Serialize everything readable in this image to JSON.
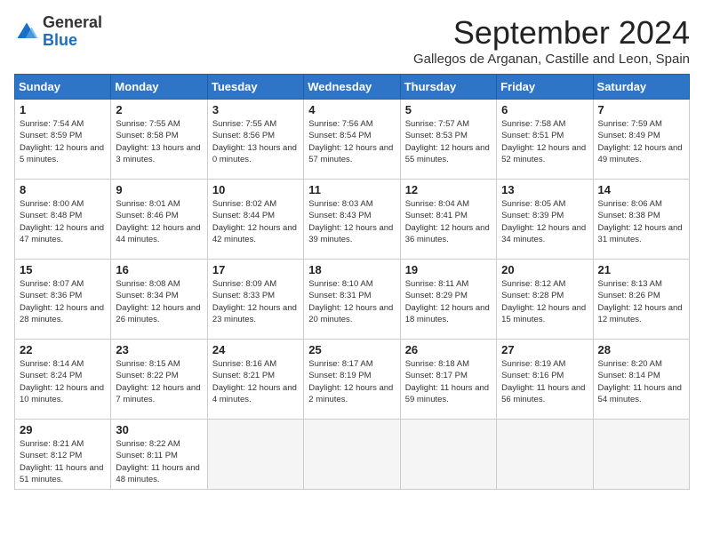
{
  "logo": {
    "general": "General",
    "blue": "Blue"
  },
  "header": {
    "month_title": "September 2024",
    "location": "Gallegos de Arganan, Castille and Leon, Spain"
  },
  "weekdays": [
    "Sunday",
    "Monday",
    "Tuesday",
    "Wednesday",
    "Thursday",
    "Friday",
    "Saturday"
  ],
  "weeks": [
    [
      {
        "day": 1,
        "sunrise": "7:54 AM",
        "sunset": "8:59 PM",
        "daylight": "12 hours and 5 minutes."
      },
      {
        "day": 2,
        "sunrise": "7:55 AM",
        "sunset": "8:58 PM",
        "daylight": "13 hours and 3 minutes."
      },
      {
        "day": 3,
        "sunrise": "7:55 AM",
        "sunset": "8:56 PM",
        "daylight": "13 hours and 0 minutes."
      },
      {
        "day": 4,
        "sunrise": "7:56 AM",
        "sunset": "8:54 PM",
        "daylight": "12 hours and 57 minutes."
      },
      {
        "day": 5,
        "sunrise": "7:57 AM",
        "sunset": "8:53 PM",
        "daylight": "12 hours and 55 minutes."
      },
      {
        "day": 6,
        "sunrise": "7:58 AM",
        "sunset": "8:51 PM",
        "daylight": "12 hours and 52 minutes."
      },
      {
        "day": 7,
        "sunrise": "7:59 AM",
        "sunset": "8:49 PM",
        "daylight": "12 hours and 49 minutes."
      }
    ],
    [
      {
        "day": 8,
        "sunrise": "8:00 AM",
        "sunset": "8:48 PM",
        "daylight": "12 hours and 47 minutes."
      },
      {
        "day": 9,
        "sunrise": "8:01 AM",
        "sunset": "8:46 PM",
        "daylight": "12 hours and 44 minutes."
      },
      {
        "day": 10,
        "sunrise": "8:02 AM",
        "sunset": "8:44 PM",
        "daylight": "12 hours and 42 minutes."
      },
      {
        "day": 11,
        "sunrise": "8:03 AM",
        "sunset": "8:43 PM",
        "daylight": "12 hours and 39 minutes."
      },
      {
        "day": 12,
        "sunrise": "8:04 AM",
        "sunset": "8:41 PM",
        "daylight": "12 hours and 36 minutes."
      },
      {
        "day": 13,
        "sunrise": "8:05 AM",
        "sunset": "8:39 PM",
        "daylight": "12 hours and 34 minutes."
      },
      {
        "day": 14,
        "sunrise": "8:06 AM",
        "sunset": "8:38 PM",
        "daylight": "12 hours and 31 minutes."
      }
    ],
    [
      {
        "day": 15,
        "sunrise": "8:07 AM",
        "sunset": "8:36 PM",
        "daylight": "12 hours and 28 minutes."
      },
      {
        "day": 16,
        "sunrise": "8:08 AM",
        "sunset": "8:34 PM",
        "daylight": "12 hours and 26 minutes."
      },
      {
        "day": 17,
        "sunrise": "8:09 AM",
        "sunset": "8:33 PM",
        "daylight": "12 hours and 23 minutes."
      },
      {
        "day": 18,
        "sunrise": "8:10 AM",
        "sunset": "8:31 PM",
        "daylight": "12 hours and 20 minutes."
      },
      {
        "day": 19,
        "sunrise": "8:11 AM",
        "sunset": "8:29 PM",
        "daylight": "12 hours and 18 minutes."
      },
      {
        "day": 20,
        "sunrise": "8:12 AM",
        "sunset": "8:28 PM",
        "daylight": "12 hours and 15 minutes."
      },
      {
        "day": 21,
        "sunrise": "8:13 AM",
        "sunset": "8:26 PM",
        "daylight": "12 hours and 12 minutes."
      }
    ],
    [
      {
        "day": 22,
        "sunrise": "8:14 AM",
        "sunset": "8:24 PM",
        "daylight": "12 hours and 10 minutes."
      },
      {
        "day": 23,
        "sunrise": "8:15 AM",
        "sunset": "8:22 PM",
        "daylight": "12 hours and 7 minutes."
      },
      {
        "day": 24,
        "sunrise": "8:16 AM",
        "sunset": "8:21 PM",
        "daylight": "12 hours and 4 minutes."
      },
      {
        "day": 25,
        "sunrise": "8:17 AM",
        "sunset": "8:19 PM",
        "daylight": "12 hours and 2 minutes."
      },
      {
        "day": 26,
        "sunrise": "8:18 AM",
        "sunset": "8:17 PM",
        "daylight": "11 hours and 59 minutes."
      },
      {
        "day": 27,
        "sunrise": "8:19 AM",
        "sunset": "8:16 PM",
        "daylight": "11 hours and 56 minutes."
      },
      {
        "day": 28,
        "sunrise": "8:20 AM",
        "sunset": "8:14 PM",
        "daylight": "11 hours and 54 minutes."
      }
    ],
    [
      {
        "day": 29,
        "sunrise": "8:21 AM",
        "sunset": "8:12 PM",
        "daylight": "11 hours and 51 minutes."
      },
      {
        "day": 30,
        "sunrise": "8:22 AM",
        "sunset": "8:11 PM",
        "daylight": "11 hours and 48 minutes."
      },
      null,
      null,
      null,
      null,
      null
    ]
  ]
}
